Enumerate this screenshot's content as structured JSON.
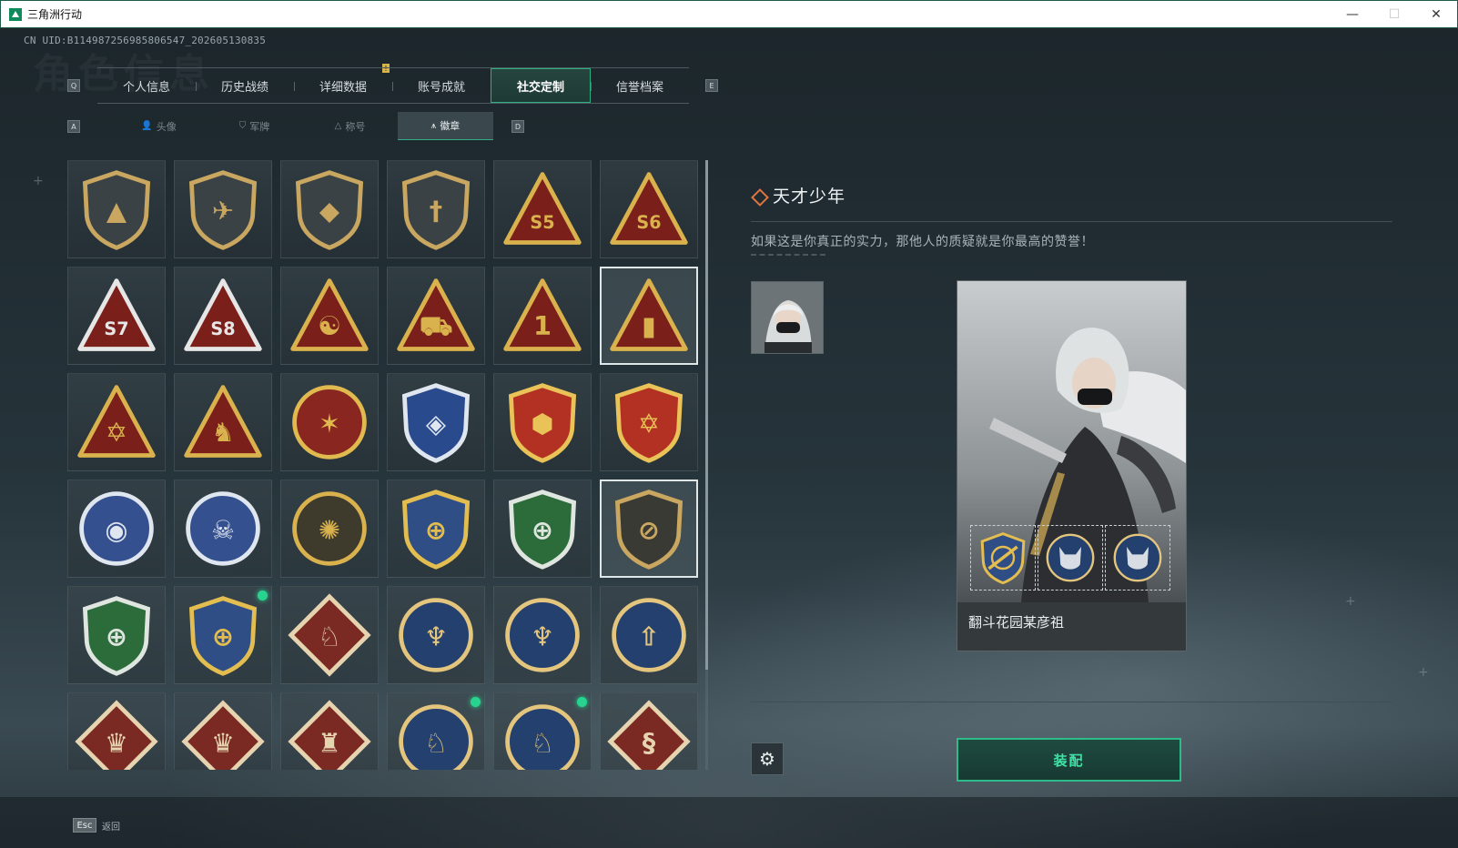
{
  "window": {
    "title": "三角洲行动",
    "controls": [
      "—",
      "☐",
      "✕"
    ]
  },
  "uid": "CN UID:B114987256985806547_202605130835",
  "bg_title": "角色信息",
  "keys": {
    "prev_tab": "Q",
    "next_tab": "E",
    "prev_sub": "A",
    "next_sub": "D"
  },
  "alert_mark": "!",
  "main_tabs": [
    {
      "label": "个人信息"
    },
    {
      "label": "历史战绩"
    },
    {
      "label": "详细数据"
    },
    {
      "label": "账号成就"
    },
    {
      "label": "社交定制",
      "active": true
    },
    {
      "label": "信誉档案"
    }
  ],
  "sub_tabs": [
    {
      "label": "头像",
      "icon": "person-icon",
      "glyph": "👤"
    },
    {
      "label": "军牌",
      "icon": "dogtag-icon",
      "glyph": "⛉"
    },
    {
      "label": "称号",
      "icon": "title-icon",
      "glyph": "△"
    },
    {
      "label": "徽章",
      "icon": "badge-icon",
      "glyph": "⩚",
      "active": true
    }
  ],
  "badges": [
    {
      "name": "delta-shield-badge",
      "shape": "shield",
      "fill": "#3a4246",
      "accent": "#c9a760",
      "sym": "▲"
    },
    {
      "name": "helicopter-shield-badge",
      "shape": "shield",
      "fill": "#3a4246",
      "accent": "#c9a760",
      "sym": "✈"
    },
    {
      "name": "hex-shield-badge",
      "shape": "shield",
      "fill": "#3a4246",
      "accent": "#c9a760",
      "sym": "◆"
    },
    {
      "name": "dagger-shield-badge",
      "shape": "shield",
      "fill": "#3a4246",
      "accent": "#c9a760",
      "sym": "†"
    },
    {
      "name": "season-s5-badge",
      "shape": "triangle",
      "fill": "#7a1f1a",
      "accent": "#d9b24e",
      "sym": "S5"
    },
    {
      "name": "season-s6-badge",
      "shape": "triangle",
      "fill": "#7a1f1a",
      "accent": "#d9b24e",
      "sym": "S6"
    },
    {
      "name": "season-s7-badge",
      "shape": "triangle",
      "fill": "#7a1f1a",
      "accent": "#e6e6e6",
      "sym": "S7"
    },
    {
      "name": "season-s8-badge",
      "shape": "triangle",
      "fill": "#7a1f1a",
      "accent": "#e6e6e6",
      "sym": "S8"
    },
    {
      "name": "hands-triangle-badge",
      "shape": "triangle",
      "fill": "#7a1f1a",
      "accent": "#d9b24e",
      "sym": "☯"
    },
    {
      "name": "tank-triangle-badge",
      "shape": "triangle",
      "fill": "#7a1f1a",
      "accent": "#d9b24e",
      "sym": "⛟"
    },
    {
      "name": "number-one-triangle-badge",
      "shape": "triangle",
      "fill": "#7a1f1a",
      "accent": "#d9b24e",
      "sym": "1"
    },
    {
      "name": "usb-triangle-badge",
      "shape": "triangle",
      "fill": "#7a1f1a",
      "accent": "#d9b24e",
      "sym": "▮",
      "selected": true
    },
    {
      "name": "star-hands-triangle-badge",
      "shape": "triangle",
      "fill": "#7a1f1a",
      "accent": "#d9b24e",
      "sym": "✡"
    },
    {
      "name": "soldiers-triangle-badge",
      "shape": "triangle",
      "fill": "#7a1f1a",
      "accent": "#d9b24e",
      "sym": "♞"
    },
    {
      "name": "lion-star-badge",
      "shape": "circle",
      "fill": "#8a2620",
      "accent": "#e0b94f",
      "sym": "✶"
    },
    {
      "name": "blue-crest-badge",
      "shape": "shield",
      "fill": "#2a4a8e",
      "accent": "#dfe6f0",
      "sym": "◈"
    },
    {
      "name": "gold-crest-badge",
      "shape": "shield",
      "fill": "#b33122",
      "accent": "#e9c357",
      "sym": "⬢"
    },
    {
      "name": "red-star-crest-badge",
      "shape": "shield",
      "fill": "#b33122",
      "accent": "#e9c357",
      "sym": "✡"
    },
    {
      "name": "eye-bird-badge",
      "shape": "circle",
      "fill": "#34508f",
      "accent": "#dfe6f0",
      "sym": "◉"
    },
    {
      "name": "skull-badge",
      "shape": "circle",
      "fill": "#34508f",
      "accent": "#dfe6f0",
      "sym": "☠"
    },
    {
      "name": "tank-sun-badge",
      "shape": "circle",
      "fill": "#3e3a2c",
      "accent": "#d9b24e",
      "sym": "✺"
    },
    {
      "name": "sniper-gold-badge",
      "shape": "shield",
      "fill": "#2f4e86",
      "accent": "#e3bd4f",
      "sym": "⊕"
    },
    {
      "name": "rifle-green-badge",
      "shape": "shield",
      "fill": "#2c6b3a",
      "accent": "#dfe6e0",
      "sym": "⊕"
    },
    {
      "name": "rifle-dark-badge",
      "shape": "shield",
      "fill": "#3a3a34",
      "accent": "#c9a760",
      "sym": "⊘",
      "selected": true
    },
    {
      "name": "sniper-green-badge",
      "shape": "shield",
      "fill": "#2c6b3a",
      "accent": "#dfe6e0",
      "sym": "⊕"
    },
    {
      "name": "sniper-gold-2-badge",
      "shape": "shield",
      "fill": "#2f4e86",
      "accent": "#e3bd4f",
      "sym": "⊕",
      "new": true
    },
    {
      "name": "wolf-diamond-badge",
      "shape": "diamond",
      "fill": "#7a2a22",
      "accent": "#e6d3b0",
      "sym": "♘"
    },
    {
      "name": "eagle-circle-badge",
      "shape": "circle",
      "fill": "#24406e",
      "accent": "#e3c57e",
      "sym": "♆"
    },
    {
      "name": "eagle-circle-2-badge",
      "shape": "circle",
      "fill": "#24406e",
      "accent": "#e3c57e",
      "sym": "♆"
    },
    {
      "name": "arrow-circle-badge",
      "shape": "circle",
      "fill": "#24406e",
      "accent": "#e3c57e",
      "sym": "⇧"
    },
    {
      "name": "dragon-diamond-badge",
      "shape": "diamond",
      "fill": "#7a2a22",
      "accent": "#e6d3b0",
      "sym": "♛"
    },
    {
      "name": "dragon-diamond-2-badge",
      "shape": "diamond",
      "fill": "#7a2a22",
      "accent": "#e6d3b0",
      "sym": "♛"
    },
    {
      "name": "runner-diamond-badge",
      "shape": "diamond",
      "fill": "#7a2a22",
      "accent": "#e6d3b0",
      "sym": "♜"
    },
    {
      "name": "wildcat-circle-badge",
      "shape": "circle",
      "fill": "#24406e",
      "accent": "#e3c57e",
      "sym": "♘",
      "new": true
    },
    {
      "name": "wildcat-circle-2-badge",
      "shape": "circle",
      "fill": "#24406e",
      "accent": "#e3c57e",
      "sym": "♘",
      "new": true
    },
    {
      "name": "snake-diamond-badge",
      "shape": "diamond",
      "fill": "#7a2a22",
      "accent": "#e6d3b0",
      "sym": "§"
    }
  ],
  "detail": {
    "title": "天才少年",
    "description": "如果这是你真正的实力，那他人的质疑就是你最高的赞誉！",
    "card_name": "翻斗花园某彦祖",
    "equip_label": "装配",
    "settings_glyph": "⚙"
  },
  "footer": {
    "esc_key": "Esc",
    "esc_label": "返回"
  },
  "colors": {
    "accent_green": "#2dbb8a",
    "active_text": "#3fe3a6",
    "new_dot": "#28d38f"
  }
}
